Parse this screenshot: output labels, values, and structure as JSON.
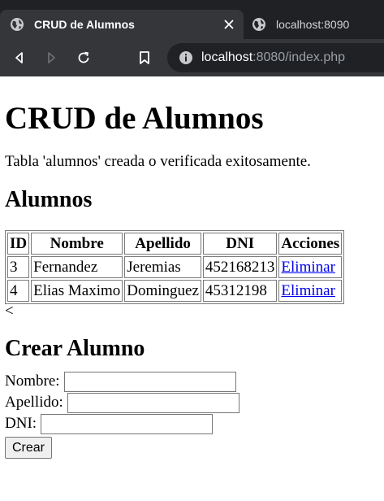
{
  "browser": {
    "tabs": [
      {
        "title": "CRUD de Alumnos",
        "icon": "globe-icon",
        "active": true
      },
      {
        "title": "localhost:8090",
        "icon": "globe-icon",
        "active": false
      }
    ],
    "close_glyph": "×",
    "url": {
      "host": "localhost",
      "rest": ":8080/index.php"
    },
    "colors": {
      "tabstrip": "#202124",
      "toolbar": "#35363a",
      "omnibox": "#202124"
    }
  },
  "page": {
    "title": "CRUD de Alumnos",
    "message": "Tabla 'alumnos' creada o verificada exitosamente.",
    "list_heading": "Alumnos",
    "table": {
      "headers": [
        "ID",
        "Nombre",
        "Apellido",
        "DNI",
        "Acciones"
      ],
      "rows": [
        {
          "id": "3",
          "nombre": "Fernandez",
          "apellido": "Jeremias",
          "dni": "452168213",
          "accion": "Eliminar"
        },
        {
          "id": "4",
          "nombre": "Elias Maximo",
          "apellido": "Dominguez",
          "dni": "45312198",
          "accion": "Eliminar"
        }
      ]
    },
    "stray_text": "<",
    "form_heading": "Crear Alumno",
    "form": {
      "nombre_label": "Nombre:",
      "apellido_label": "Apellido:",
      "dni_label": "DNI:",
      "nombre_value": "",
      "apellido_value": "",
      "dni_value": "",
      "submit_label": "Crear"
    },
    "colors": {
      "link": "#0000ee",
      "border": "#7a7a7a"
    }
  }
}
